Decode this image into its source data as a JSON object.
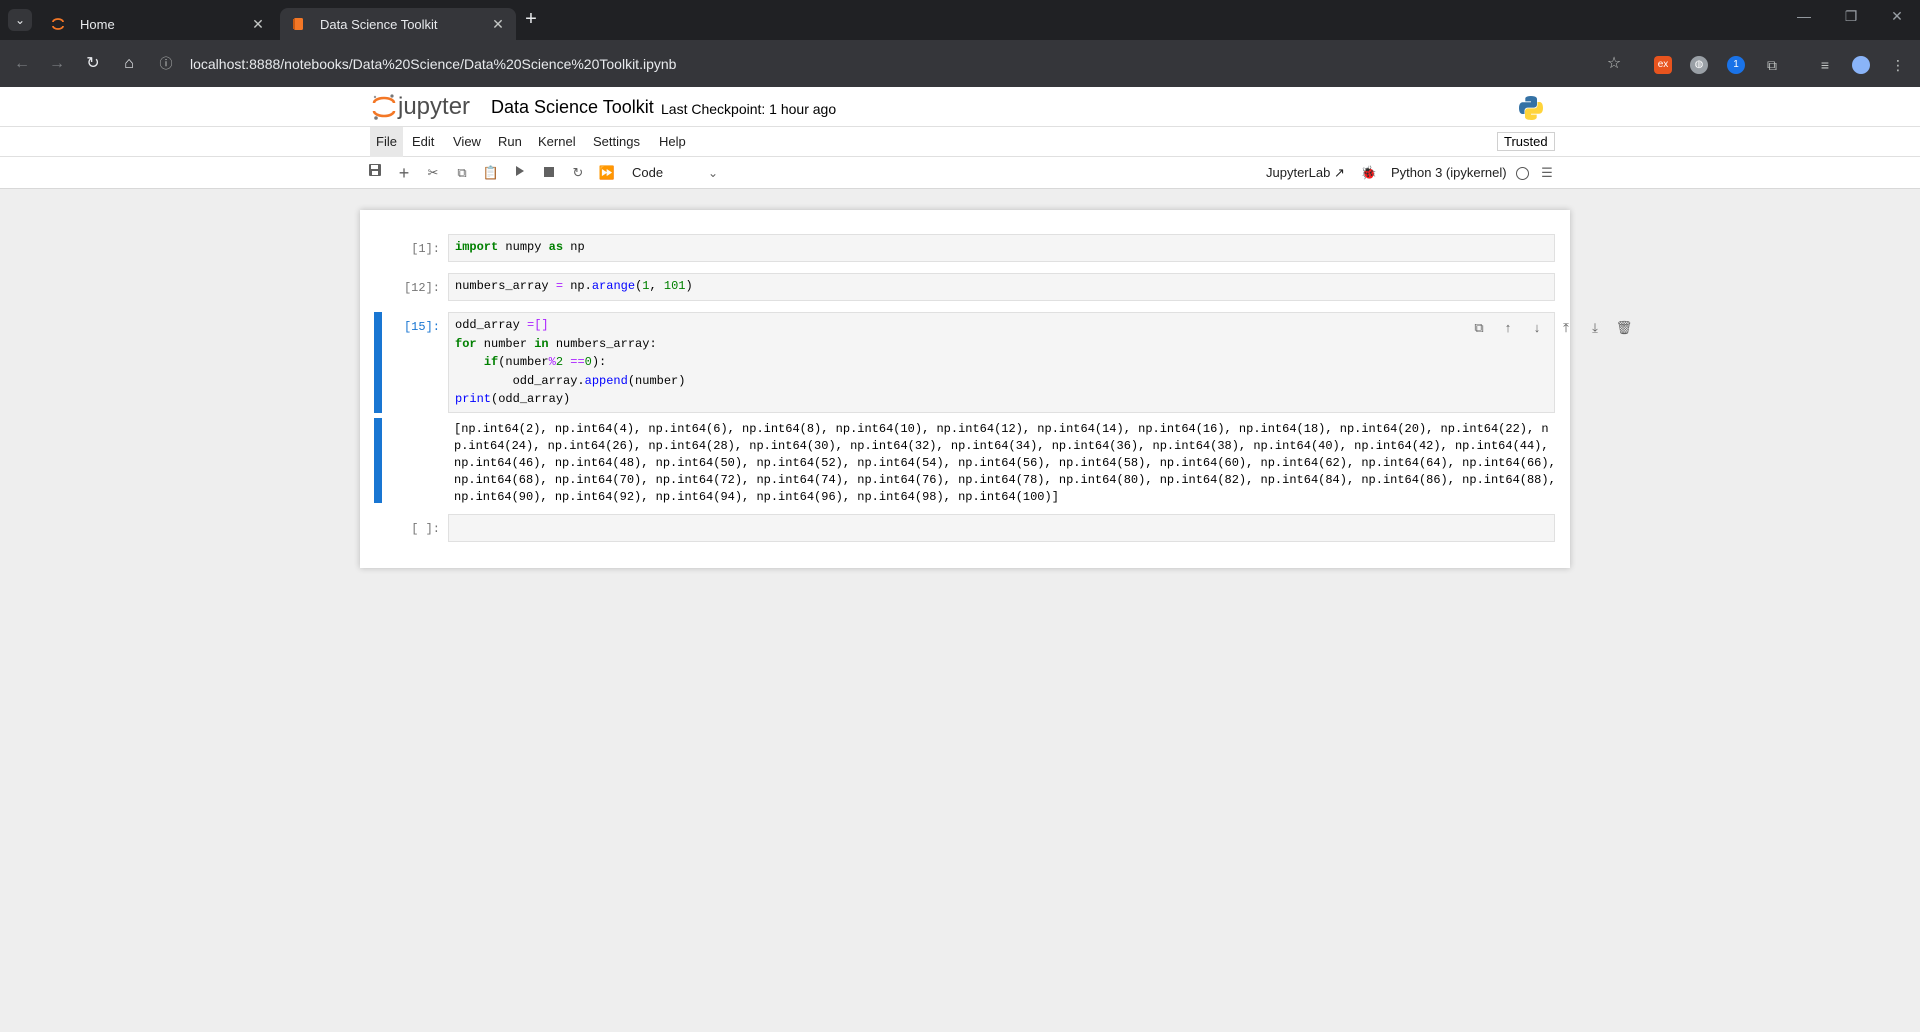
{
  "browser": {
    "tabs": [
      {
        "title": "Home",
        "icon": "jupyter-favicon"
      },
      {
        "title": "Data Science Toolkit",
        "icon": "notebook-favicon"
      }
    ],
    "url": "localhost:8888/notebooks/Data%20Science/Data%20Science%20Toolkit.ipynb"
  },
  "jupyter": {
    "logo_text": "jupyter",
    "notebook_title": "Data Science Toolkit",
    "checkpoint": "Last Checkpoint: 1 hour ago",
    "menu": [
      "File",
      "Edit",
      "View",
      "Run",
      "Kernel",
      "Settings",
      "Help"
    ],
    "trusted": "Trusted",
    "cell_type": "Code",
    "jupyterlab_link": "JupyterLab",
    "kernel_name": "Python 3 (ipykernel)"
  },
  "cells": [
    {
      "prompt": "[1]:"
    },
    {
      "prompt": "[12]:"
    },
    {
      "prompt": "[15]:",
      "output": "[np.int64(2), np.int64(4), np.int64(6), np.int64(8), np.int64(10), np.int64(12), np.int64(14), np.int64(16), np.int64(18), np.int64(20), np.int64(22), np.int64(24), np.int64(26), np.int64(28), np.int64(30), np.int64(32), np.int64(34), np.int64(36), np.int64(38), np.int64(40), np.int64(42), np.int64(44), np.int64(46), np.int64(48), np.int64(50), np.int64(52), np.int64(54), np.int64(56), np.int64(58), np.int64(60), np.int64(62), np.int64(64), np.int64(66), np.int64(68), np.int64(70), np.int64(72), np.int64(74), np.int64(76), np.int64(78), np.int64(80), np.int64(82), np.int64(84), np.int64(86), np.int64(88), np.int64(90), np.int64(92), np.int64(94), np.int64(96), np.int64(98), np.int64(100)]"
    },
    {
      "prompt": "[ ]:"
    }
  ],
  "code": {
    "c1": {
      "kw1": "import",
      "t1": " numpy ",
      "kw2": "as",
      "t2": " np"
    },
    "c2": {
      "t1": "numbers_array ",
      "op1": "=",
      "t2": " np.",
      "fn1": "arange",
      "t3": "(",
      "n1": "1",
      "t4": ", ",
      "n2": "101",
      "t5": ")"
    },
    "c3": {
      "l1_t1": "odd_array ",
      "l1_op": "=[]",
      "l2_kw1": "for",
      "l2_t1": " number ",
      "l2_kw2": "in",
      "l2_t2": " numbers_array:",
      "l3_ind": "    ",
      "l3_kw": "if",
      "l3_t1": "(number",
      "l3_op1": "%",
      "l3_n1": "2",
      "l3_t2": " ",
      "l3_op2": "==",
      "l3_n2": "0",
      "l3_t3": "):",
      "l4_ind": "        ",
      "l4_t1": "odd_array.",
      "l4_fn": "append",
      "l4_t2": "(number)",
      "l5_fn": "print",
      "l5_t1": "(odd_array)"
    }
  },
  "icons": {
    "toolbar": [
      "save-icon",
      "add-cell-icon",
      "cut-icon",
      "copy-icon",
      "paste-icon",
      "run-icon",
      "stop-icon",
      "restart-icon",
      "fast-forward-icon"
    ],
    "cell_toolbar": [
      "duplicate-icon",
      "move-up-icon",
      "move-down-icon",
      "insert-above-icon",
      "insert-below-icon",
      "delete-icon"
    ]
  },
  "colors": {
    "active_cell": "#1976d2",
    "keyword": "#008000",
    "operator": "#aa22ff",
    "number": "#008000",
    "function": "#0000ff"
  }
}
